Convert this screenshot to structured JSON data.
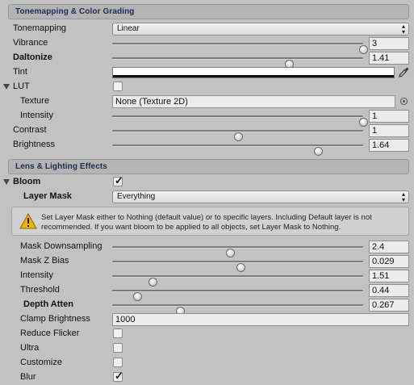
{
  "sections": {
    "tonemapping": "Tonemapping & Color Grading",
    "lens": "Lens & Lighting Effects"
  },
  "tonemapping": {
    "label": "Tonemapping",
    "value": "Linear"
  },
  "vibrance": {
    "label": "Vibrance",
    "value": "3",
    "fraction": 1.0
  },
  "daltonize": {
    "label": "Daltonize",
    "value": "1.41",
    "fraction": 0.705
  },
  "tint": {
    "label": "Tint",
    "color": "#ffffff"
  },
  "lut": {
    "label": "LUT",
    "checked": false,
    "texture_label": "Texture",
    "texture_value": "None (Texture 2D)",
    "intensity_label": "Intensity",
    "intensity_value": "1",
    "intensity_fraction": 1.0
  },
  "contrast": {
    "label": "Contrast",
    "value": "1",
    "fraction": 0.5
  },
  "brightness": {
    "label": "Brightness",
    "value": "1.64",
    "fraction": 0.82
  },
  "bloom": {
    "label": "Bloom",
    "checked": true,
    "layer_mask_label": "Layer Mask",
    "layer_mask_value": "Everything",
    "help_text": "Set Layer Mask either to Nothing (default value) or to specific layers. Including Default layer is not recommended. If you want bloom to be applied to all objects, set Layer Mask to Nothing.",
    "mask_downsampling": {
      "label": "Mask Downsampling",
      "value": "2.4",
      "fraction": 0.47
    },
    "mask_z_bias": {
      "label": "Mask Z Bias",
      "value": "0.029",
      "fraction": 0.51
    },
    "intensity": {
      "label": "Intensity",
      "value": "1.51",
      "fraction": 0.16
    },
    "threshold": {
      "label": "Threshold",
      "value": "0.44",
      "fraction": 0.1
    },
    "depth_atten": {
      "label": "Depth Atten",
      "value": "0.267",
      "fraction": 0.27
    },
    "clamp_brightness": {
      "label": "Clamp Brightness",
      "value": "1000"
    },
    "reduce_flicker": {
      "label": "Reduce Flicker",
      "checked": false
    },
    "ultra": {
      "label": "Ultra",
      "checked": false
    },
    "customize": {
      "label": "Customize",
      "checked": false
    },
    "blur": {
      "label": "Blur",
      "checked": true
    }
  },
  "icons": {
    "dropdown": "dropdown-arrows-icon",
    "picker": "eyedropper-icon",
    "object_picker": "object-picker-icon",
    "warning": "warning-icon",
    "foldout": "foldout-arrow-icon"
  },
  "colors": {
    "background": "#c2c2c2",
    "section_header_text": "#1d2a56",
    "warning": "#f0b400"
  }
}
